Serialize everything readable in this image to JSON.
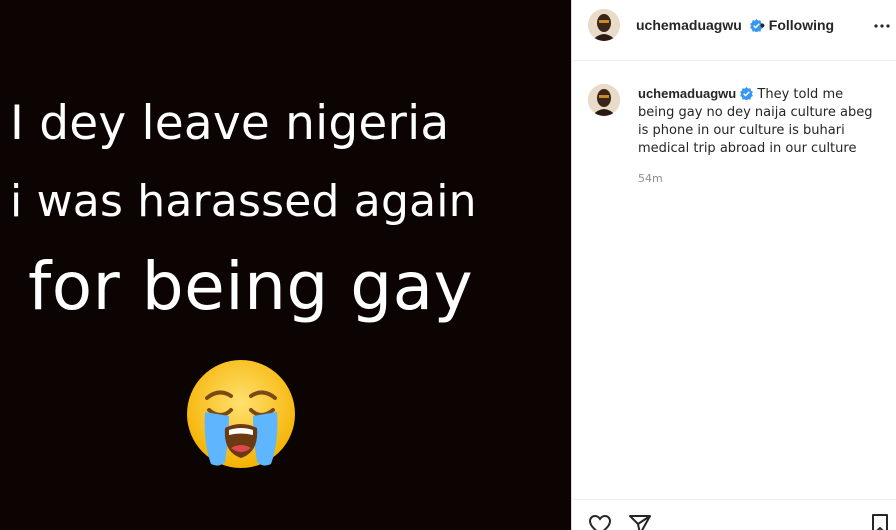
{
  "media": {
    "lines": [
      "I dey leave nigeria",
      "i was harassed again",
      "for being gay"
    ],
    "emoji": "loudly-crying-face",
    "background_color": "#0b0403"
  },
  "header": {
    "username": "uchemaduagwu",
    "following": "• Following",
    "verified_color": "#3897f0"
  },
  "caption": {
    "username": "uchemaduagwu",
    "text": "They told me being gay no dey naija culture abeg is phone in our culture is buhari medical trip abroad in our culture",
    "timestamp": "54m"
  },
  "icons": {
    "more": "more-options-icon",
    "like": "heart-icon",
    "share": "share-icon",
    "save": "bookmark-icon"
  }
}
